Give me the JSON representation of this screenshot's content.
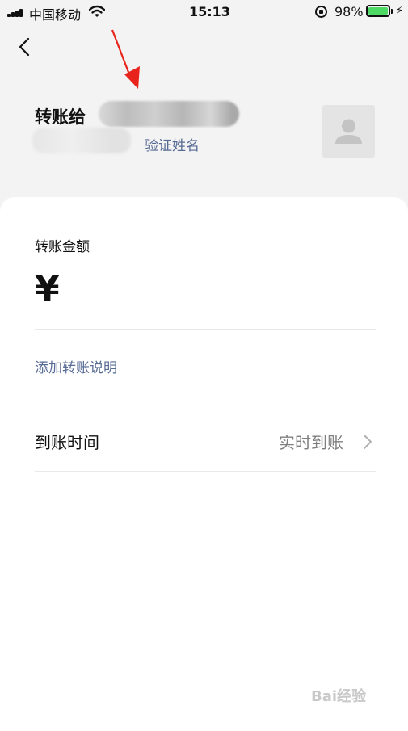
{
  "status_bar": {
    "carrier": "中国移动",
    "time": "15:13",
    "battery_percent_label": "98%",
    "battery_level": 0.98
  },
  "header": {
    "transfer_to_label": "转账给",
    "verify_name_link": "验证姓名"
  },
  "form": {
    "amount_label": "转账金额",
    "currency_symbol": "¥",
    "amount_value": "",
    "add_note_link": "添加转账说明",
    "arrival_time_label": "到账时间",
    "arrival_time_value": "实时到账"
  },
  "colors": {
    "link": "#576b95",
    "annotation_arrow": "#e8231c",
    "battery_green": "#4cd964"
  },
  "icons": [
    "back-chevron-icon",
    "wifi-icon",
    "rotation-lock-icon",
    "battery-icon",
    "charging-bolt-icon",
    "user-avatar-icon",
    "chevron-right-icon"
  ],
  "watermark": "Bai经验"
}
